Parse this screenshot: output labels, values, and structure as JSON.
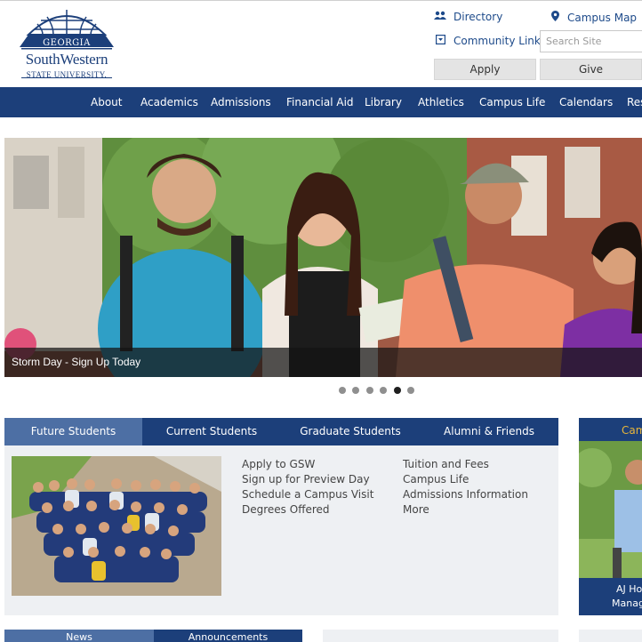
{
  "logo": {
    "line1": "GEORGIA",
    "line2": "SouthWestern",
    "line3": "STATE UNIVERSITY."
  },
  "utility": {
    "directory": "Directory",
    "campus_map": "Campus Map",
    "community_links": "Community Links",
    "search_placeholder": "Search Site",
    "apply": "Apply",
    "give": "Give"
  },
  "nav": [
    "About",
    "Academics",
    "Admissions",
    "Financial Aid",
    "Library",
    "Athletics",
    "Campus Life",
    "Calendars",
    "Res"
  ],
  "hero": {
    "caption": "Storm Day - Sign Up Today",
    "slide_count": 6,
    "active_slide": 5
  },
  "tabs": [
    "Future Students",
    "Current Students",
    "Graduate Students",
    "Alumni & Friends"
  ],
  "active_tab": 0,
  "links_col1": [
    "Apply to GSW",
    "Sign up for Preview Day",
    "Schedule a Campus Visit",
    "Degrees Offered"
  ],
  "links_col2": [
    "Tuition and Fees",
    "Campus Life",
    "Admissions Information",
    "More"
  ],
  "teaser": {
    "title": "Cam",
    "line1": "AJ Ho",
    "line2": "Manag"
  },
  "bottom_tabs": [
    "News",
    "Announcements"
  ],
  "colors": {
    "navy": "#1c3f7a",
    "tab_active": "#4d6fa4",
    "gold": "#e8b63a",
    "panel_bg": "#eef0f3"
  }
}
